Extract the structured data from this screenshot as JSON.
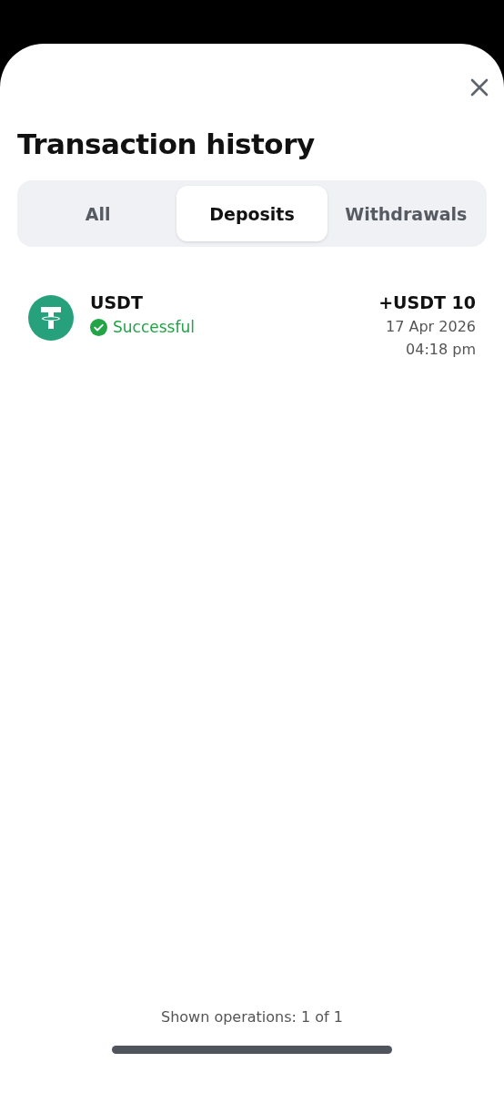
{
  "title": "Transaction history",
  "tabs": [
    {
      "label": "All",
      "selected": false
    },
    {
      "label": "Deposits",
      "selected": true
    },
    {
      "label": "Withdrawals",
      "selected": false
    }
  ],
  "transactions": [
    {
      "asset": "USDT",
      "status": {
        "label": "Successful",
        "kind": "success"
      },
      "amount": "+USDT 10",
      "date": "17 Apr 2026",
      "time": "04:18 pm"
    }
  ],
  "footer": "Shown operations: 1 of 1"
}
